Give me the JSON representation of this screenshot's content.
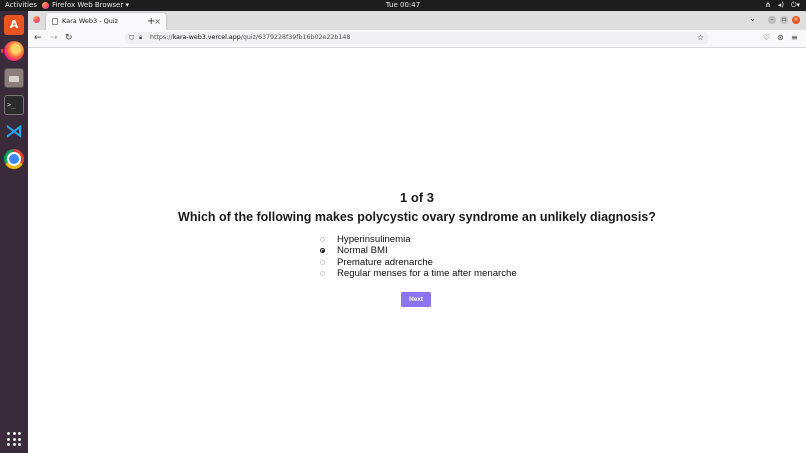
{
  "system": {
    "activities_label": "Activities",
    "app_menu_label": "Firefox Web Browser ▾",
    "clock": "Tue 00:47",
    "tray_icons": [
      "network-icon",
      "volume-icon",
      "power-icon"
    ]
  },
  "dock": {
    "items": [
      "ubuntu-software-icon",
      "firefox-icon",
      "files-icon",
      "terminal-icon",
      "vscode-icon",
      "chrome-icon",
      "show-applications-icon"
    ]
  },
  "browser": {
    "tab_title": "Kara Web3 - Quiz",
    "tab_close": "×",
    "new_tab": "+",
    "url_prefix": "https://",
    "url_host": "kara-web3.vercel.app",
    "url_path": "/quiz/6379228f39fb16b02e22b148"
  },
  "quiz": {
    "progress": "1 of 3",
    "question": "Which of the following makes polycystic ovary syndrome an unlikely diagnosis?",
    "options": [
      {
        "label": "Hyperinsulinemia",
        "checked": false
      },
      {
        "label": "Normal BMI",
        "checked": true
      },
      {
        "label": "Premature adrenarche",
        "checked": false
      },
      {
        "label": "Regular menses for a time after menarche",
        "checked": false
      }
    ],
    "next_label": "Next"
  },
  "colors": {
    "accent": "#8b74f0",
    "dock_bg": "#3a2b3a",
    "topbar_bg": "#1d1d1d"
  }
}
